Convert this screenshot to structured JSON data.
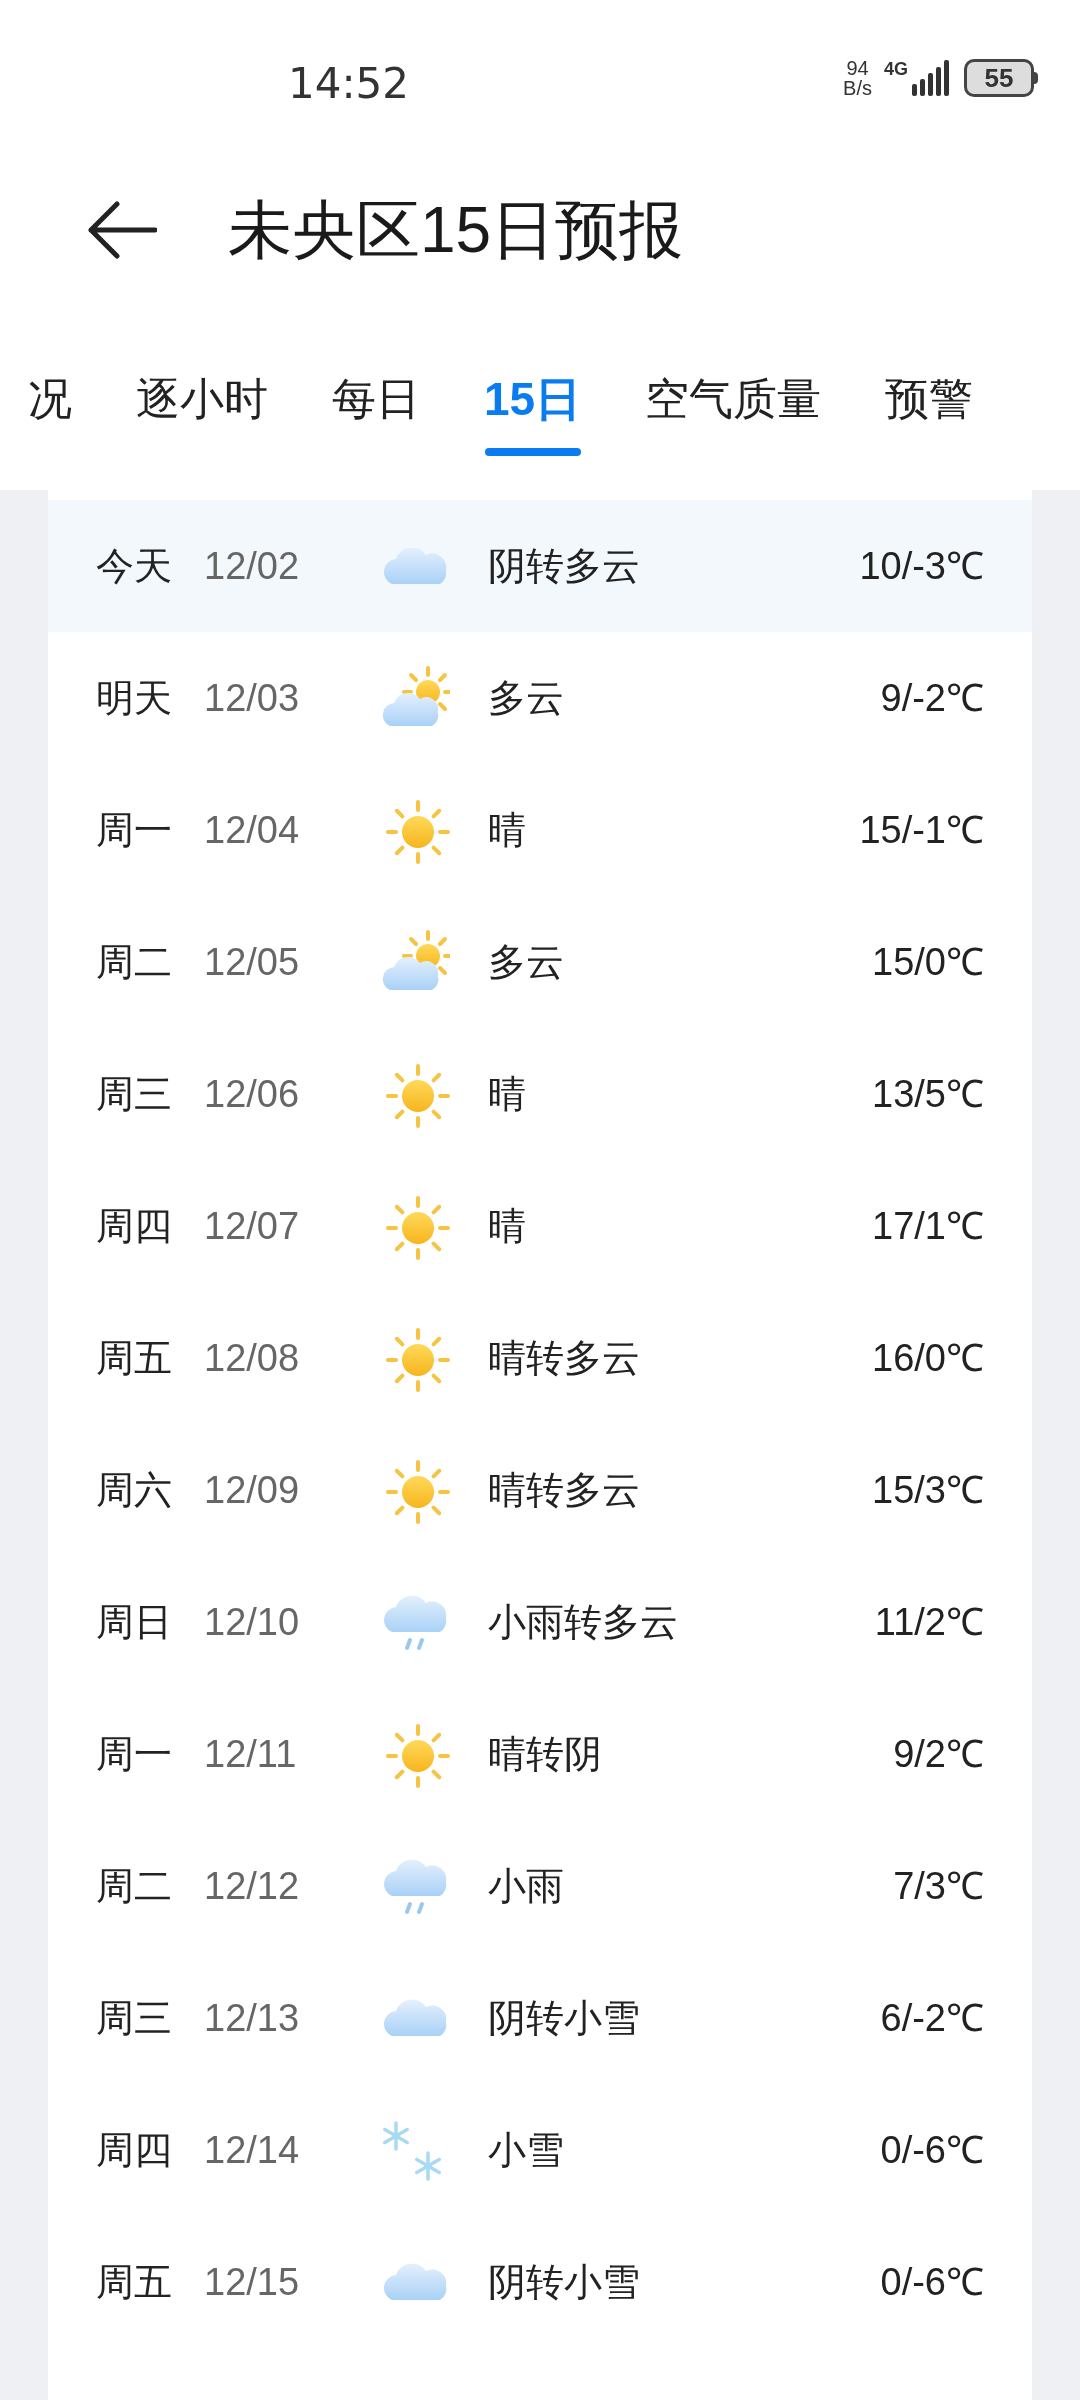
{
  "status_bar": {
    "time": "14:52",
    "net_speed_value": "94",
    "net_speed_unit": "B/s",
    "network": "4G",
    "battery": "55"
  },
  "header": {
    "title": "未央区15日预报"
  },
  "tabs": [
    {
      "label": "况",
      "selected": false
    },
    {
      "label": "逐小时",
      "selected": false
    },
    {
      "label": "每日",
      "selected": false
    },
    {
      "label": "15日",
      "selected": true
    },
    {
      "label": "空气质量",
      "selected": false
    },
    {
      "label": "预警",
      "selected": false
    }
  ],
  "days": [
    {
      "day": "今天",
      "date": "12/02",
      "kind": "cloudy",
      "condition": "阴转多云",
      "temp": "10/-3℃",
      "selected": true
    },
    {
      "day": "明天",
      "date": "12/03",
      "kind": "partly_cloudy",
      "condition": "多云",
      "temp": "9/-2℃",
      "selected": false
    },
    {
      "day": "周一",
      "date": "12/04",
      "kind": "sunny",
      "condition": "晴",
      "temp": "15/-1℃",
      "selected": false
    },
    {
      "day": "周二",
      "date": "12/05",
      "kind": "partly_cloudy",
      "condition": "多云",
      "temp": "15/0℃",
      "selected": false
    },
    {
      "day": "周三",
      "date": "12/06",
      "kind": "sunny",
      "condition": "晴",
      "temp": "13/5℃",
      "selected": false
    },
    {
      "day": "周四",
      "date": "12/07",
      "kind": "sunny",
      "condition": "晴",
      "temp": "17/1℃",
      "selected": false
    },
    {
      "day": "周五",
      "date": "12/08",
      "kind": "sunny",
      "condition": "晴转多云",
      "temp": "16/0℃",
      "selected": false
    },
    {
      "day": "周六",
      "date": "12/09",
      "kind": "sunny",
      "condition": "晴转多云",
      "temp": "15/3℃",
      "selected": false
    },
    {
      "day": "周日",
      "date": "12/10",
      "kind": "rain",
      "condition": "小雨转多云",
      "temp": "11/2℃",
      "selected": false
    },
    {
      "day": "周一",
      "date": "12/11",
      "kind": "sunny",
      "condition": "晴转阴",
      "temp": "9/2℃",
      "selected": false
    },
    {
      "day": "周二",
      "date": "12/12",
      "kind": "rain",
      "condition": "小雨",
      "temp": "7/3℃",
      "selected": false
    },
    {
      "day": "周三",
      "date": "12/13",
      "kind": "cloudy",
      "condition": "阴转小雪",
      "temp": "6/-2℃",
      "selected": false
    },
    {
      "day": "周四",
      "date": "12/14",
      "kind": "snow",
      "condition": "小雪",
      "temp": "0/-6℃",
      "selected": false
    },
    {
      "day": "周五",
      "date": "12/15",
      "kind": "cloudy",
      "condition": "阴转小雪",
      "temp": "0/-6℃",
      "selected": false
    }
  ]
}
